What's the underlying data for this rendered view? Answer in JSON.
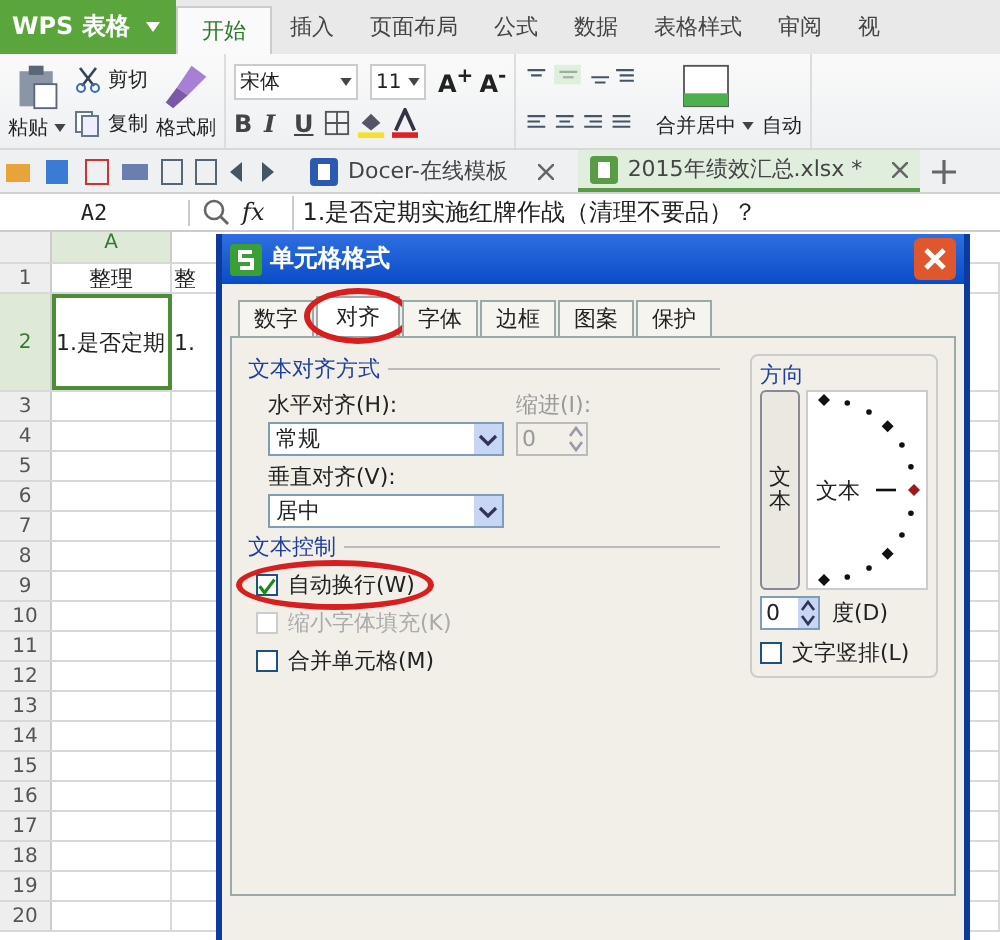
{
  "app": {
    "brand": "WPS 表格"
  },
  "menu_tabs": [
    {
      "label": "开始",
      "selected": true
    },
    {
      "label": "插入",
      "selected": false
    },
    {
      "label": "页面布局",
      "selected": false
    },
    {
      "label": "公式",
      "selected": false
    },
    {
      "label": "数据",
      "selected": false
    },
    {
      "label": "表格样式",
      "selected": false
    },
    {
      "label": "审阅",
      "selected": false
    },
    {
      "label": "视",
      "selected": false
    }
  ],
  "toolbar": {
    "paste": "粘贴",
    "cut": "剪切",
    "copy": "复制",
    "format_painter": "格式刷",
    "font": "宋体",
    "size": "11",
    "grow": "A$^{+}$",
    "shrink": "A$^{-}$",
    "format_buttons": [
      "B",
      "I",
      "U"
    ],
    "merge": "合并居中",
    "wrap": "自动"
  },
  "doc_tabs": [
    {
      "label": "Docer-在线模板",
      "selected": false
    },
    {
      "label": "2015年绩效汇总.xlsx *",
      "selected": true
    }
  ],
  "formula_bar": {
    "name_box": "A2",
    "fx": "fx",
    "value": "1.是否定期实施红牌作战（清理不要品）？"
  },
  "grid": {
    "columns": [
      {
        "label": "A",
        "selected": true
      }
    ],
    "rows": [
      {
        "label": "1",
        "selected": false,
        "cells": [
          "整理",
          "整"
        ]
      },
      {
        "label": "2",
        "selected": true,
        "cells": [
          "1.是否定期",
          "1."
        ]
      },
      {
        "label": "3",
        "selected": false,
        "cells": []
      },
      {
        "label": "4",
        "selected": false,
        "cells": []
      },
      {
        "label": "5",
        "selected": false,
        "cells": []
      },
      {
        "label": "6",
        "selected": false,
        "cells": []
      },
      {
        "label": "7",
        "selected": false,
        "cells": []
      },
      {
        "label": "8",
        "selected": false,
        "cells": []
      },
      {
        "label": "9",
        "selected": false,
        "cells": []
      },
      {
        "label": "10",
        "selected": false,
        "cells": []
      },
      {
        "label": "11",
        "selected": false,
        "cells": []
      },
      {
        "label": "12",
        "selected": false,
        "cells": []
      },
      {
        "label": "13",
        "selected": false,
        "cells": []
      },
      {
        "label": "14",
        "selected": false,
        "cells": []
      },
      {
        "label": "15",
        "selected": false,
        "cells": []
      },
      {
        "label": "16",
        "selected": false,
        "cells": []
      },
      {
        "label": "17",
        "selected": false,
        "cells": []
      },
      {
        "label": "18",
        "selected": false,
        "cells": []
      },
      {
        "label": "19",
        "selected": false,
        "cells": []
      },
      {
        "label": "20",
        "selected": false,
        "cells": []
      }
    ]
  },
  "dialog": {
    "title": "单元格格式",
    "tabs": [
      {
        "label": "数字",
        "selected": false,
        "highlighted": false
      },
      {
        "label": "对齐",
        "selected": true,
        "highlighted": true
      },
      {
        "label": "字体",
        "selected": false,
        "highlighted": false
      },
      {
        "label": "边框",
        "selected": false,
        "highlighted": false
      },
      {
        "label": "图案",
        "selected": false,
        "highlighted": false
      },
      {
        "label": "保护",
        "selected": false,
        "highlighted": false
      }
    ],
    "alignment_group": "文本对齐方式",
    "horizontal_label": "水平对齐(H):",
    "horizontal_value": "常规",
    "indent_label": "缩进(I):",
    "indent_value": "0",
    "indent_disabled": true,
    "vertical_label": "垂直对齐(V):",
    "vertical_value": "居中",
    "control_group": "文本控制",
    "checkboxes": [
      {
        "label": "自动换行(W)",
        "checked": true,
        "disabled": false,
        "highlighted": true
      },
      {
        "label": "缩小字体填充(K)",
        "checked": false,
        "disabled": true,
        "highlighted": false
      },
      {
        "label": "合并单元格(M)",
        "checked": false,
        "disabled": false,
        "highlighted": false
      }
    ],
    "orientation": {
      "title": "方向",
      "vertical_text": "文本",
      "dial_text": "文本",
      "degrees": "0",
      "degrees_label": "度(D)",
      "stacked_label": "文字竖排(L)",
      "stacked": false
    }
  }
}
